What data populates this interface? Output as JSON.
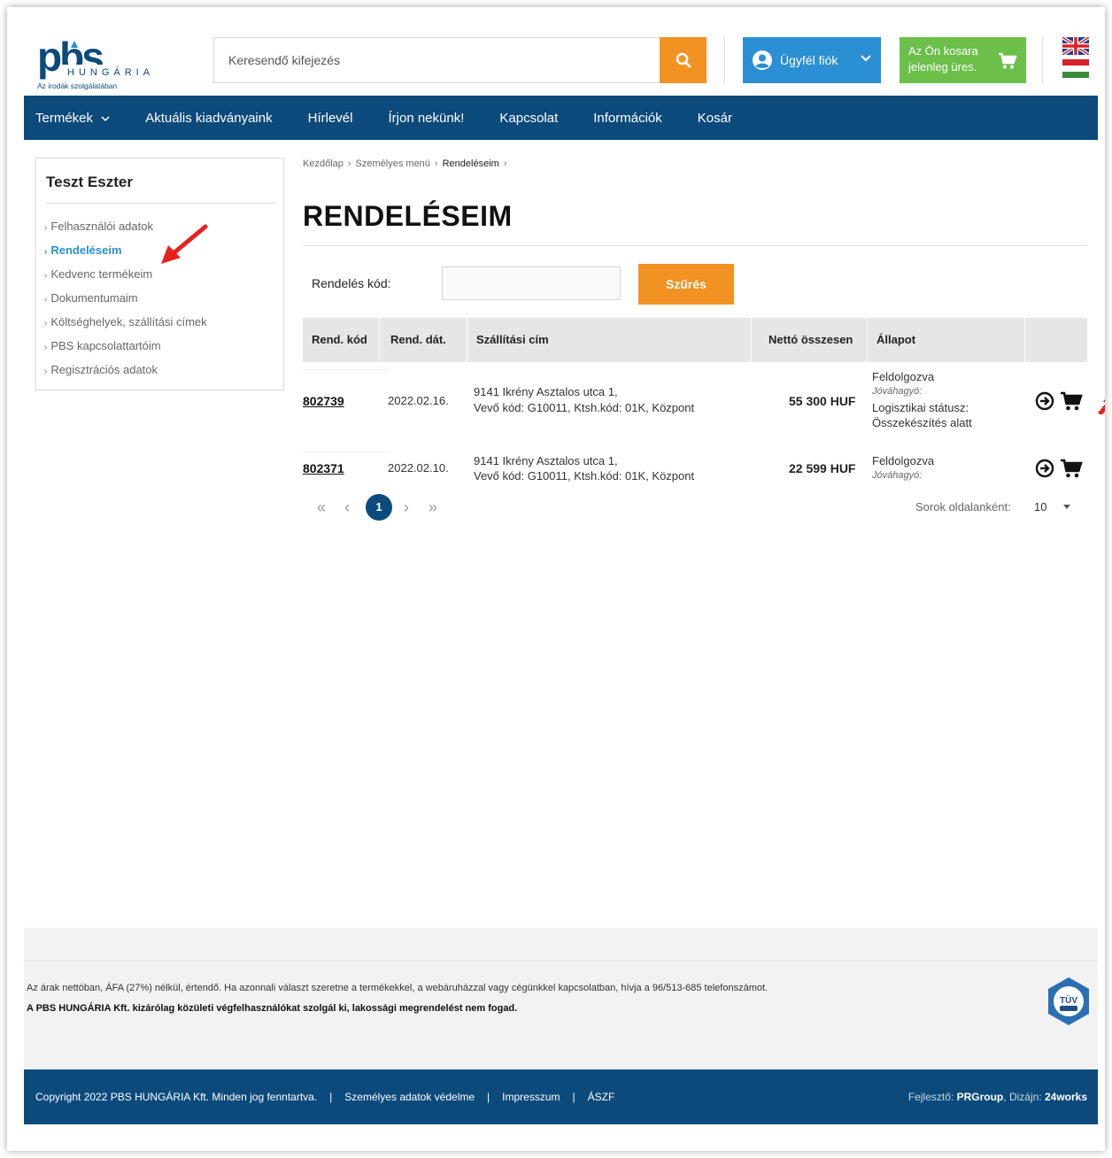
{
  "header": {
    "logo": {
      "text": "pbs",
      "sub": "HUNGÁRIA",
      "tagline": "Az irodák szolgálatában"
    },
    "search": {
      "placeholder": "Keresendő kifejezés"
    },
    "account_label": "Ügyfél fiók",
    "cart_text_line1": "Az Ön kosara",
    "cart_text_line2": "jelenleg üres."
  },
  "nav": {
    "items": [
      "Termékek",
      "Aktuális kiadványaink",
      "Hírlevél",
      "Írjon nekünk!",
      "Kapcsolat",
      "Információk",
      "Kosár"
    ]
  },
  "sidebar": {
    "user_name": "Teszt Eszter",
    "items": [
      {
        "label": "Felhasználói adatok"
      },
      {
        "label": "Rendeléseim"
      },
      {
        "label": "Kedvenc termékeim"
      },
      {
        "label": "Dokumentumaim"
      },
      {
        "label": "Költséghelyek, szállítási címek"
      },
      {
        "label": "PBS kapcsolattartóim"
      },
      {
        "label": "Regisztrációs adatok"
      }
    ]
  },
  "breadcrumb": [
    "Kezdőlap",
    "Személyes menü",
    "Rendeléseim"
  ],
  "page_title": "RENDELÉSEIM",
  "filter": {
    "label": "Rendelés kód:",
    "value": "",
    "button": "Szűrés"
  },
  "table": {
    "headers": [
      "Rend. kód",
      "Rend. dát.",
      "Szállítási cím",
      "Nettó összesen",
      "Állapot"
    ],
    "rows": [
      {
        "code": "802739",
        "date": "2022.02.16.",
        "address1": "9141 Ikrény Asztalos utca 1,",
        "address2": "Vevő kód: G10011, Ktsh.kód: 01K, Központ",
        "net": "55 300 HUF",
        "status": "Feldolgozva",
        "approver": "Jóváhagyó:",
        "logistics1": "Logisztikai státusz:",
        "logistics2": "Összekészítés alatt"
      },
      {
        "code": "802371",
        "date": "2022.02.10.",
        "address1": "9141 Ikrény Asztalos utca 1,",
        "address2": "Vevő kód: G10011, Ktsh.kód: 01K, Központ",
        "net": "22 599 HUF",
        "status": "Feldolgozva",
        "approver": "Jóváhagyó:"
      }
    ]
  },
  "pagination": {
    "first": "«",
    "prev": "‹",
    "current": "1",
    "next": "›",
    "last": "»",
    "rows_per_page_label": "Sorok oldalanként:",
    "rows_per_page": "10"
  },
  "footer": {
    "note": "Az árak nettóban, ÁFA (27%) nélkül, értendő. Ha azonnali választ szeretne a termékekkel, a webáruházzal vagy cégünkkel kapcsolatban, hívja a 96/513-685 telefonszámot.",
    "note_bold": "A PBS HUNGÁRIA Kft. kizárólag közületi végfelhasználókat szolgál ki, lakossági megrendelést nem fogad.",
    "copyright": "Copyright 2022 PBS HUNGÁRIA Kft. Minden jog fenntartva.",
    "links": [
      "Személyes adatok védelme",
      "Impresszum",
      "ÁSZF"
    ],
    "dev_label": "Fejlesztő:",
    "dev_name": "PRGroup",
    "design_label": "Dizájn:",
    "design_name": "24works",
    "tuv_text": "TÜV"
  },
  "colors": {
    "nav_blue": "#0c4a7c",
    "orange": "#f29223",
    "account_blue": "#2b8fd4",
    "cart_green": "#6cc04a",
    "annotation_red": "#e8211d"
  }
}
